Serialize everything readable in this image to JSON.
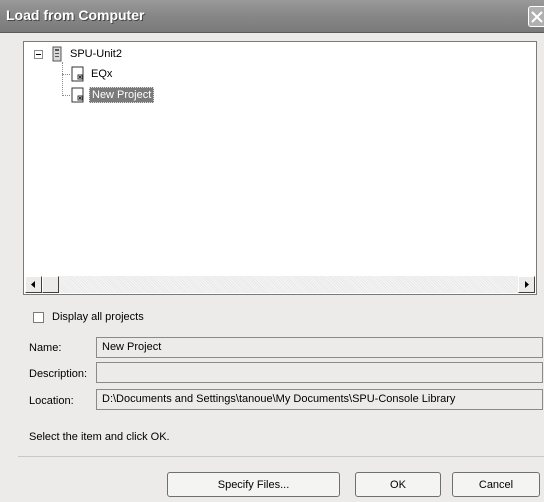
{
  "window": {
    "title": "Load from Computer"
  },
  "tree": {
    "root": {
      "label": "SPU-Unit2",
      "icon": "unit-icon"
    },
    "children": [
      {
        "label": "EQx",
        "icon": "project-file-icon",
        "selected": false
      },
      {
        "label": "New Project",
        "icon": "project-file-icon",
        "selected": true
      }
    ]
  },
  "options": {
    "display_all_label": "Display all projects",
    "display_all_checked": false
  },
  "details": {
    "name_label": "Name:",
    "name_value": "New Project",
    "description_label": "Description:",
    "description_value": "",
    "location_label": "Location:",
    "location_value": "D:\\Documents and Settings\\tanoue\\My Documents\\SPU-Console Library"
  },
  "hint": "Select the item and click OK.",
  "buttons": {
    "specify_files": "Specify Files...",
    "ok": "OK",
    "cancel": "Cancel"
  }
}
